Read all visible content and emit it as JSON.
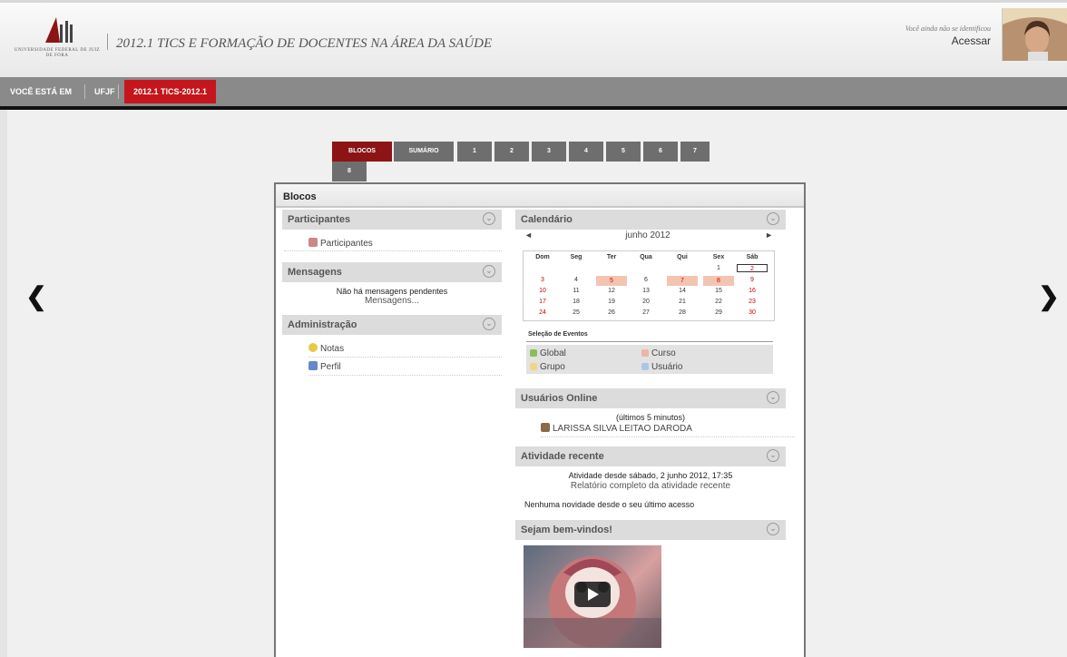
{
  "header": {
    "logo_text": "UFJF",
    "university": "Universidade Federal de Juiz de Fora",
    "course_title": "2012.1 TICS E FORMAÇÃO DE DOCENTES NA ÁREA DA SAÚDE",
    "login_note": "Você ainda não se identificou",
    "login_link": "Acessar"
  },
  "breadcrumb": {
    "label": "VOCÊ ESTÁ EM",
    "items": [
      "UFJF",
      "2012.1 TICS-2012.1"
    ]
  },
  "tabs": [
    "BLOCOS",
    "SUMÁRIO",
    "1",
    "2",
    "3",
    "4",
    "5",
    "6",
    "7",
    "8"
  ],
  "panel_title": "Blocos",
  "blocks": {
    "participantes": {
      "title": "Participantes",
      "link": "Participantes"
    },
    "mensagens": {
      "title": "Mensagens",
      "text": "Não há mensagens pendentes",
      "link": "Mensagens..."
    },
    "administracao": {
      "title": "Administração",
      "items": [
        "Notas",
        "Perfil"
      ]
    },
    "calendario": {
      "title": "Calendário",
      "prev": "◄",
      "next": "►",
      "month": "junho 2012",
      "days_header": [
        "Dom",
        "Seg",
        "Ter",
        "Qua",
        "Qui",
        "Sex",
        "Sáb"
      ],
      "weeks": [
        [
          "",
          "",
          "",
          "",
          "",
          "1",
          "2"
        ],
        [
          "3",
          "4",
          "5",
          "6",
          "7",
          "8",
          "9"
        ],
        [
          "10",
          "11",
          "12",
          "13",
          "14",
          "15",
          "16"
        ],
        [
          "17",
          "18",
          "19",
          "20",
          "21",
          "22",
          "23"
        ],
        [
          "24",
          "25",
          "26",
          "27",
          "28",
          "29",
          "30"
        ]
      ],
      "event_days": [
        "5",
        "7",
        "8"
      ],
      "today": "2",
      "events_title": "Seleção de Eventos",
      "filters": [
        "Global",
        "Curso",
        "Grupo",
        "Usuário"
      ]
    },
    "usuarios_online": {
      "title": "Usuários Online",
      "note": "(últimos 5 minutos)",
      "user": "LARISSA SILVA LEITAO DARODA"
    },
    "atividade": {
      "title": "Atividade recente",
      "since": "Atividade desde sábado, 2 junho 2012, 17:35",
      "report_link": "Relatório completo da atividade recente",
      "none": "Nenhuma novidade desde o seu último acesso"
    },
    "bemvindos": {
      "title": "Sejam bem-vindos!"
    }
  },
  "nav": {
    "prev": "❮",
    "next": "❯"
  },
  "colors": {
    "accent": "#c4161c",
    "tab_active": "#8c1414",
    "tab": "#6e6e6e",
    "event": "#f4c4b2"
  }
}
